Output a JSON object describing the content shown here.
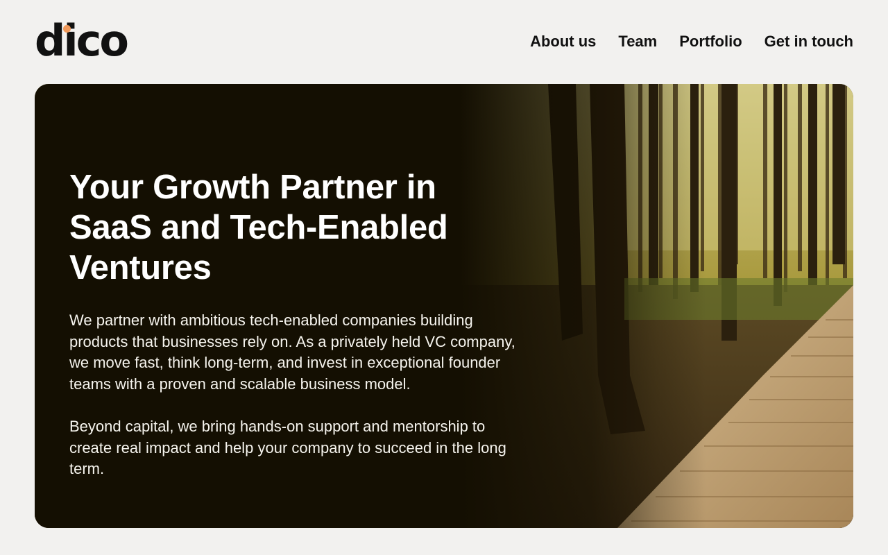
{
  "brand": {
    "name": "dico",
    "dot_color": "#f0995a"
  },
  "nav": {
    "items": [
      {
        "label": "About us"
      },
      {
        "label": "Team"
      },
      {
        "label": "Portfolio"
      },
      {
        "label": "Get in touch"
      }
    ]
  },
  "hero": {
    "title": "Your Growth Partner in SaaS and Tech-Enabled Ventures",
    "paragraphs": [
      "We partner with ambitious tech-enabled companies building products that businesses rely on. As a privately held VC company, we move fast, think long-term, and invest in exceptional founder teams with a proven and scalable business model.",
      "Beyond capital, we bring hands-on support and mentorship to create real impact and help your company to succeed in the long term."
    ],
    "image": "forest-boardwalk-image"
  },
  "colors": {
    "page_bg": "#f2f1ef",
    "hero_bg": "#140f02",
    "text_dark": "#111111",
    "text_light": "#ffffff"
  }
}
